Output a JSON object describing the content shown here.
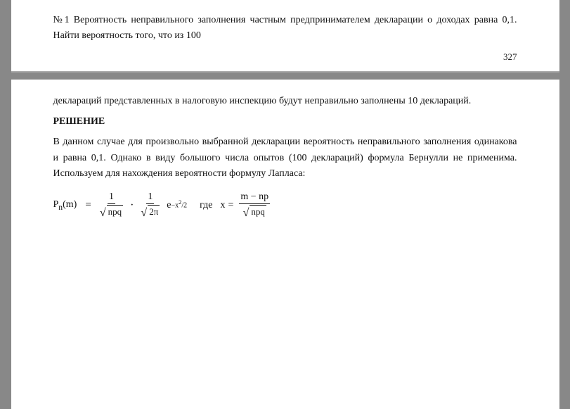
{
  "page": {
    "top": {
      "task_text": "№1  Вероятность неправильного заполнения частным предпринимателем декларации о доходах равна 0,1. Найти вероятность того, что из 100",
      "page_number": "327"
    },
    "bottom": {
      "continuation": "деклараций представленных в налоговую инспекцию будут неправильно заполнены 10 деклараций.",
      "solution_label": "РЕШЕНИЕ",
      "solution_text": "В данном случае для произвольно выбранной декларации вероятность неправильного заполнения одинакова и равна 0,1. Однако в виду большого числа опытов (100 деклараций) формула Бернулли не применима. Используем для нахождения вероятности формулу Лапласа:",
      "formula": {
        "pn_label": "P",
        "pn_sub": "n",
        "pn_arg": "(m)",
        "equals": "=",
        "frac1_num": "1",
        "frac1_den": "√npq",
        "dot": "·",
        "frac2_num": "1",
        "frac2_den": "√2π",
        "exp_base": "e",
        "exp_power": "−x²/2",
        "where": "где",
        "x_eq": "x",
        "x_equals": "=",
        "x_num": "m − np",
        "x_den": "√npq"
      }
    }
  }
}
